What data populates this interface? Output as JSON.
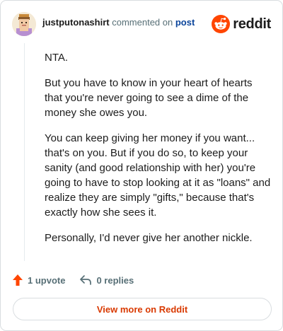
{
  "comment": {
    "username": "justputonashirt",
    "action_text": "commented on",
    "post_link": "post",
    "paragraphs": [
      "NTA.",
      "But you have to know in your heart of hearts that you're never going to see a dime of the money she owes you.",
      "You can keep giving her money if you want... that's on you. But if you do so, to keep your sanity (and good relationship with her) you're going to have to stop looking at it as \"loans\" and realize they are simply \"gifts,\" because that's exactly how she sees it.",
      "Personally, I'd never give her another nickle."
    ]
  },
  "brand": {
    "name": "reddit",
    "color": "#ff4500"
  },
  "actions": {
    "upvote_label": "1 upvote",
    "replies_label": "0 replies"
  },
  "footer": {
    "view_more_label": "View more on Reddit",
    "link_color": "#d93900"
  },
  "icons": [
    "avatar",
    "reddit-logo-icon",
    "upvote-arrow-icon",
    "reply-arrow-icon"
  ]
}
